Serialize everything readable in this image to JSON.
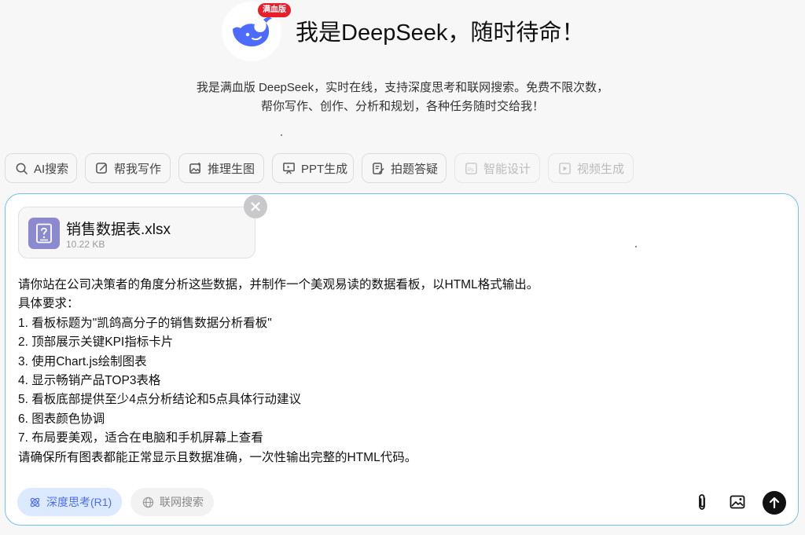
{
  "header": {
    "badge": "满血版",
    "title": "我是DeepSeek，随时待命！",
    "subtitle_lines": [
      "我是满血版 DeepSeek，实时在线，支持深度思考和联网搜索。免费不限次数，",
      "帮你写作、创作、分析和规划，各种任务随时交给我！"
    ]
  },
  "chips": [
    {
      "label": "AI搜索",
      "icon": "search-icon",
      "enabled": true
    },
    {
      "label": "帮我写作",
      "icon": "edit-icon",
      "enabled": true
    },
    {
      "label": "推理生图",
      "icon": "image-plus-icon",
      "enabled": true
    },
    {
      "label": "PPT生成",
      "icon": "presentation-icon",
      "enabled": true
    },
    {
      "label": "拍题答疑",
      "icon": "document-edit-icon",
      "enabled": true
    },
    {
      "label": "智能设计",
      "icon": "ps-icon",
      "enabled": false
    },
    {
      "label": "视频生成",
      "icon": "video-icon",
      "enabled": false
    }
  ],
  "attachment": {
    "name": "销售数据表.xlsx",
    "size": "10.22 KB"
  },
  "prompt_lines": [
    "请你站在公司决策者的角度分析这些数据，并制作一个美观易读的数据看板，以HTML格式输出。",
    "具体要求：",
    "1. 看板标题为\"凯鸽高分子的销售数据分析看板\"",
    "2. 顶部展示关键KPI指标卡片",
    "3. 使用Chart.js绘制图表",
    "4. 显示畅销产品TOP3表格",
    "5. 看板底部提供至少4点分析结论和5点具体行动建议",
    "6. 图表颜色协调",
    "7. 布局要美观，适合在电脑和手机屏幕上查看",
    "请确保所有图表都能正常显示且数据准确，一次性输出完整的HTML代码。"
  ],
  "toolbar": {
    "deep_think_label": "深度思考(R1)",
    "web_search_label": "联网搜索"
  },
  "colors": {
    "accent": "#4d6bfe",
    "badge": "#e5202b",
    "card_border": "#71c1f1"
  }
}
